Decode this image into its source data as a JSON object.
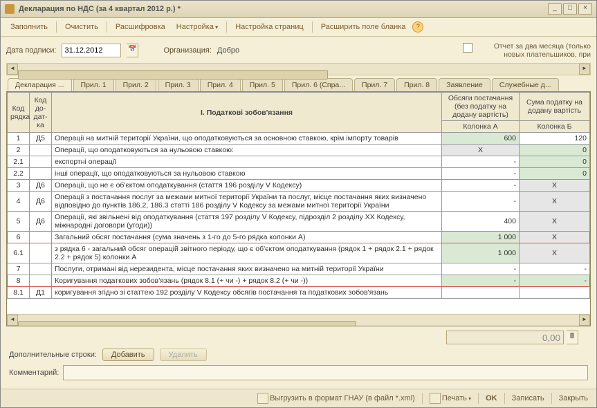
{
  "window": {
    "title": "Декларация по НДС (за 4 квартал 2012 р.) *"
  },
  "toolbar": {
    "fill": "Заполнить",
    "clear": "Очистить",
    "decode": "Расшифровка",
    "tune": "Настройка",
    "pages": "Настройка страниц",
    "expand": "Расширить поле бланка"
  },
  "meta": {
    "date_label": "Дата подписи:",
    "date_value": "31.12.2012",
    "org_label": "Организация:",
    "org_value": "Добро",
    "two_month_check": "Отчет за два месяца (только новых плательшиков, при"
  },
  "tabs": [
    "Декларация ...",
    "Прил. 1",
    "Прил. 2",
    "Прил. 3",
    "Прил. 4",
    "Прил. 5",
    "Прил. 6 (Спра...",
    "Прил. 7",
    "Прил. 8",
    "Заявление",
    "Служебные д..."
  ],
  "grid_headers": {
    "row_code": "Код рядка",
    "add_code": "Код до-дат-ка",
    "section": "I. Податкові зобов'язання",
    "colA_top": "Обсяги постачання (без податку на додану вартість)",
    "colB_top": "Сума податку на додану вартість",
    "colA": "Колонка А",
    "colB": "Колонка Б"
  },
  "rows": [
    {
      "n": "1",
      "add": "Д5",
      "text": "Операції на митній території України, що оподатковуються за основною ставкою, крім імпорту товарів",
      "a": "600",
      "b": "120",
      "aCls": "readonlyA",
      "bCls": ""
    },
    {
      "n": "2",
      "add": "",
      "text": "Операції, що оподатковуються за нульовою ставкою:",
      "a": "X",
      "b": "0",
      "aCls": "readonlyGrey",
      "bCls": "readonlyA"
    },
    {
      "n": "2.1",
      "add": "",
      "text": "експортні операції",
      "a": "-",
      "b": "0",
      "aCls": "",
      "bCls": "readonlyA"
    },
    {
      "n": "2.2",
      "add": "",
      "text": "інші операції, що оподатковуються за нульовою ставкою",
      "a": "-",
      "b": "0",
      "aCls": "",
      "bCls": "readonlyA"
    },
    {
      "n": "3",
      "add": "Д6",
      "text": "Операції, що не є об'єктом оподаткування (стаття 196 розділу V Кодексу)",
      "a": "-",
      "b": "X",
      "aCls": "",
      "bCls": "readonlyGrey"
    },
    {
      "n": "4",
      "add": "Д6",
      "text": "Операції з постачання послуг за межами митної території України та послуг, місце постачання яких визначено відповідно до пунктів 186.2, 186.3 статті 186 розділу V Кодексу за межами митної території України",
      "a": "-",
      "b": "X",
      "aCls": "",
      "bCls": "readonlyGrey"
    },
    {
      "n": "5",
      "add": "Д6",
      "text": "Операції, які звільнені від оподаткування (стаття 197 розділу V Кодексу, підрозділ 2 розділу ХХ Кодексу, міжнародні договори (угоди))",
      "a": "400",
      "b": "X",
      "aCls": "",
      "bCls": "readonlyGrey"
    },
    {
      "n": "6",
      "add": "",
      "text": "Загальний обсяг постачання (сума значень з 1-го до 5-го рядка колонки А)",
      "a": "1 000",
      "b": "X",
      "aCls": "readonlyA",
      "bCls": "readonlyGrey",
      "hl": true
    },
    {
      "n": "6.1",
      "add": "",
      "text": "з рядка 6 - загальний обсяг операцій звітного періоду, що є об'єктом оподаткування (рядок 1 + рядок 2.1 + рядок 2.2 + рядок 5) колонки А",
      "a": "1 000",
      "b": "X",
      "aCls": "readonlyA",
      "bCls": "readonlyGrey"
    },
    {
      "n": "7",
      "add": "",
      "text": "Послуги, отримані від нерезидента, місце постачання яких визначено на митній території України",
      "a": "-",
      "b": "-",
      "aCls": "",
      "bCls": ""
    },
    {
      "n": "8",
      "add": "",
      "text": "Коригування податкових зобов'язань (рядок 8.1 (+ чи -) + рядок 8.2 (+ чи -))",
      "a": "-",
      "b": "-",
      "aCls": "readonlyA",
      "bCls": "readonlyA",
      "hl": true
    },
    {
      "n": "8.1",
      "add": "Д1",
      "text": "коригування згідно зі статтею 192 розділу V Кодексу обсягів постачання та податкових зобов'язань",
      "a": "",
      "b": "",
      "aCls": "",
      "bCls": ""
    }
  ],
  "footer": {
    "sum_value": "0,00",
    "extra_label": "Дополнительные строки:",
    "add_btn": "Добавить",
    "del_btn": "Удалить",
    "comment_label": "Комментарий:"
  },
  "status": {
    "export": "Выгрузить в формат ГНАУ (в файл *.xml)",
    "print": "Печать",
    "ok": "OK",
    "save": "Записать",
    "close": "Закрыть"
  }
}
